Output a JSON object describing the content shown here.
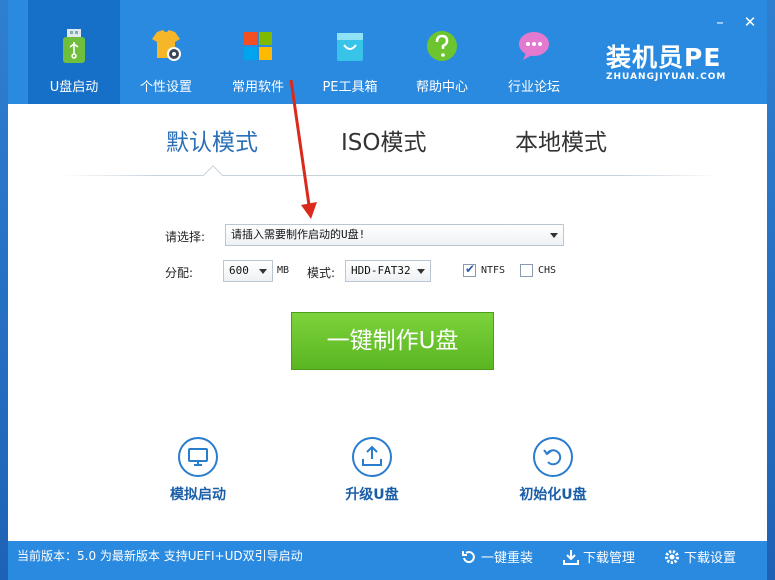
{
  "header": {
    "tabs": [
      {
        "label": "U盘启动",
        "icon": "usb-drive-icon",
        "active": true
      },
      {
        "label": "个性设置",
        "icon": "tshirt-gear-icon",
        "active": false
      },
      {
        "label": "常用软件",
        "icon": "windows-tiles-icon",
        "active": false
      },
      {
        "label": "PE工具箱",
        "icon": "bag-icon",
        "active": false
      },
      {
        "label": "帮助中心",
        "icon": "help-icon",
        "active": false
      },
      {
        "label": "行业论坛",
        "icon": "chat-bubble-icon",
        "active": false
      }
    ],
    "brand_cn": "装机员PE",
    "brand_en": "ZHUANGJIYUAN.COM",
    "minimize": "–",
    "close": "✕"
  },
  "modes": {
    "default": "默认模式",
    "iso": "ISO模式",
    "local": "本地模式"
  },
  "form": {
    "select_label": "请选择:",
    "select_value": "请插入需要制作启动的U盘!",
    "alloc_label": "分配:",
    "alloc_value": "600",
    "alloc_unit": "MB",
    "mode_label": "模式:",
    "mode_value": "HDD-FAT32",
    "ntfs_label": "NTFS",
    "ntfs_checked": true,
    "chs_label": "CHS",
    "chs_checked": false
  },
  "main_button": "一键制作U盘",
  "actions": {
    "simulate": "模拟启动",
    "upgrade": "升级U盘",
    "init": "初始化U盘"
  },
  "status": {
    "version_text": "当前版本：5.0 为最新版本 支持UEFI+UD双引导启动",
    "reinstall": "一键重装",
    "download_mgr": "下载管理",
    "download_settings": "下载设置"
  },
  "colors": {
    "header_blue": "#2a8ae0",
    "active_tab": "#1670c7",
    "green_button": "#6cc42e",
    "accent_text": "#1a5ea8"
  }
}
